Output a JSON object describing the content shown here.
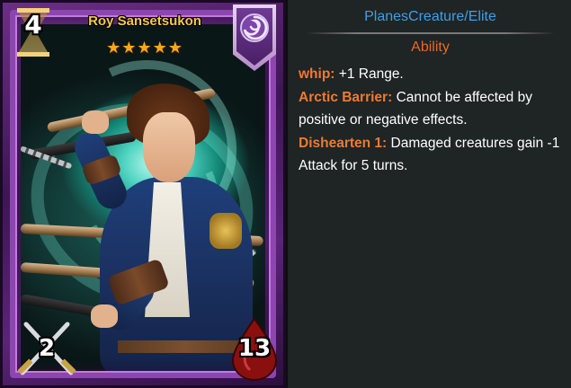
{
  "card": {
    "name": "Roy Sansetsukon",
    "cost": "4",
    "stars": "★★★★★",
    "star_count": 5,
    "attack": "2",
    "health": "13",
    "faction_icon": "swirl-vortex-icon",
    "frame_color": "#8d45b0",
    "name_color": "#f3c84a"
  },
  "info": {
    "header": "PlanesCreature/Elite",
    "section_title": "Ability",
    "abilities": [
      {
        "name": "whip:",
        "text": "+1 Range."
      },
      {
        "name": "Arctic Barrier:",
        "text": "Cannot be affected by positive or negative effects."
      },
      {
        "name": "Dishearten 1:",
        "text": "Damaged creatures gain -1 Attack for 5 turns."
      }
    ],
    "header_color": "#3aa0e8",
    "title_color": "#e76a1f",
    "ability_name_color": "#f07a2e"
  }
}
